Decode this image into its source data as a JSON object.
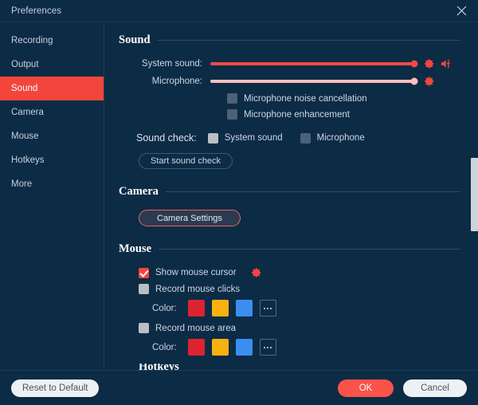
{
  "window": {
    "title": "Preferences",
    "close_icon": "close-icon"
  },
  "sidebar": {
    "items": [
      {
        "label": "Recording",
        "active": false
      },
      {
        "label": "Output",
        "active": false
      },
      {
        "label": "Sound",
        "active": true
      },
      {
        "label": "Camera",
        "active": false
      },
      {
        "label": "Mouse",
        "active": false
      },
      {
        "label": "Hotkeys",
        "active": false
      },
      {
        "label": "More",
        "active": false
      }
    ]
  },
  "sound": {
    "heading": "Sound",
    "system_sound": {
      "label": "System sound:",
      "value": 100,
      "gear_icon": "gear-icon",
      "speaker_icon": "speaker-mute-icon",
      "color": "#f04a42"
    },
    "microphone": {
      "label": "Microphone:",
      "value": 100,
      "gear_icon": "gear-icon",
      "color": "#fac0be"
    },
    "options": [
      {
        "label": "Microphone noise cancellation",
        "checked": false
      },
      {
        "label": "Microphone enhancement",
        "checked": false
      }
    ],
    "sound_check": {
      "label": "Sound check:",
      "options": [
        {
          "label": "System sound",
          "checked": false
        },
        {
          "label": "Microphone",
          "checked": false
        }
      ],
      "start_button": "Start sound check"
    }
  },
  "camera": {
    "heading": "Camera",
    "settings_button": "Camera Settings"
  },
  "mouse": {
    "heading": "Mouse",
    "show_cursor": {
      "label": "Show mouse cursor",
      "checked": true,
      "gear_icon": "gear-icon"
    },
    "record_clicks": {
      "label": "Record mouse clicks",
      "checked": false
    },
    "record_clicks_color": {
      "label": "Color:",
      "swatches": [
        "#dc2430",
        "#f9b111",
        "#3b8ef0"
      ],
      "more_label": "more-colors"
    },
    "record_area": {
      "label": "Record mouse area",
      "checked": false
    },
    "record_area_color": {
      "label": "Color:",
      "swatches": [
        "#dc2430",
        "#f9b111",
        "#3b8ef0"
      ],
      "more_label": "more-colors"
    },
    "next_section_clipped": "Hotkeys"
  },
  "footer": {
    "reset": "Reset to Default",
    "ok": "OK",
    "cancel": "Cancel"
  },
  "colors": {
    "background": "#0c2b45",
    "accent": "#f2463c",
    "text": "#ccd8e3"
  }
}
